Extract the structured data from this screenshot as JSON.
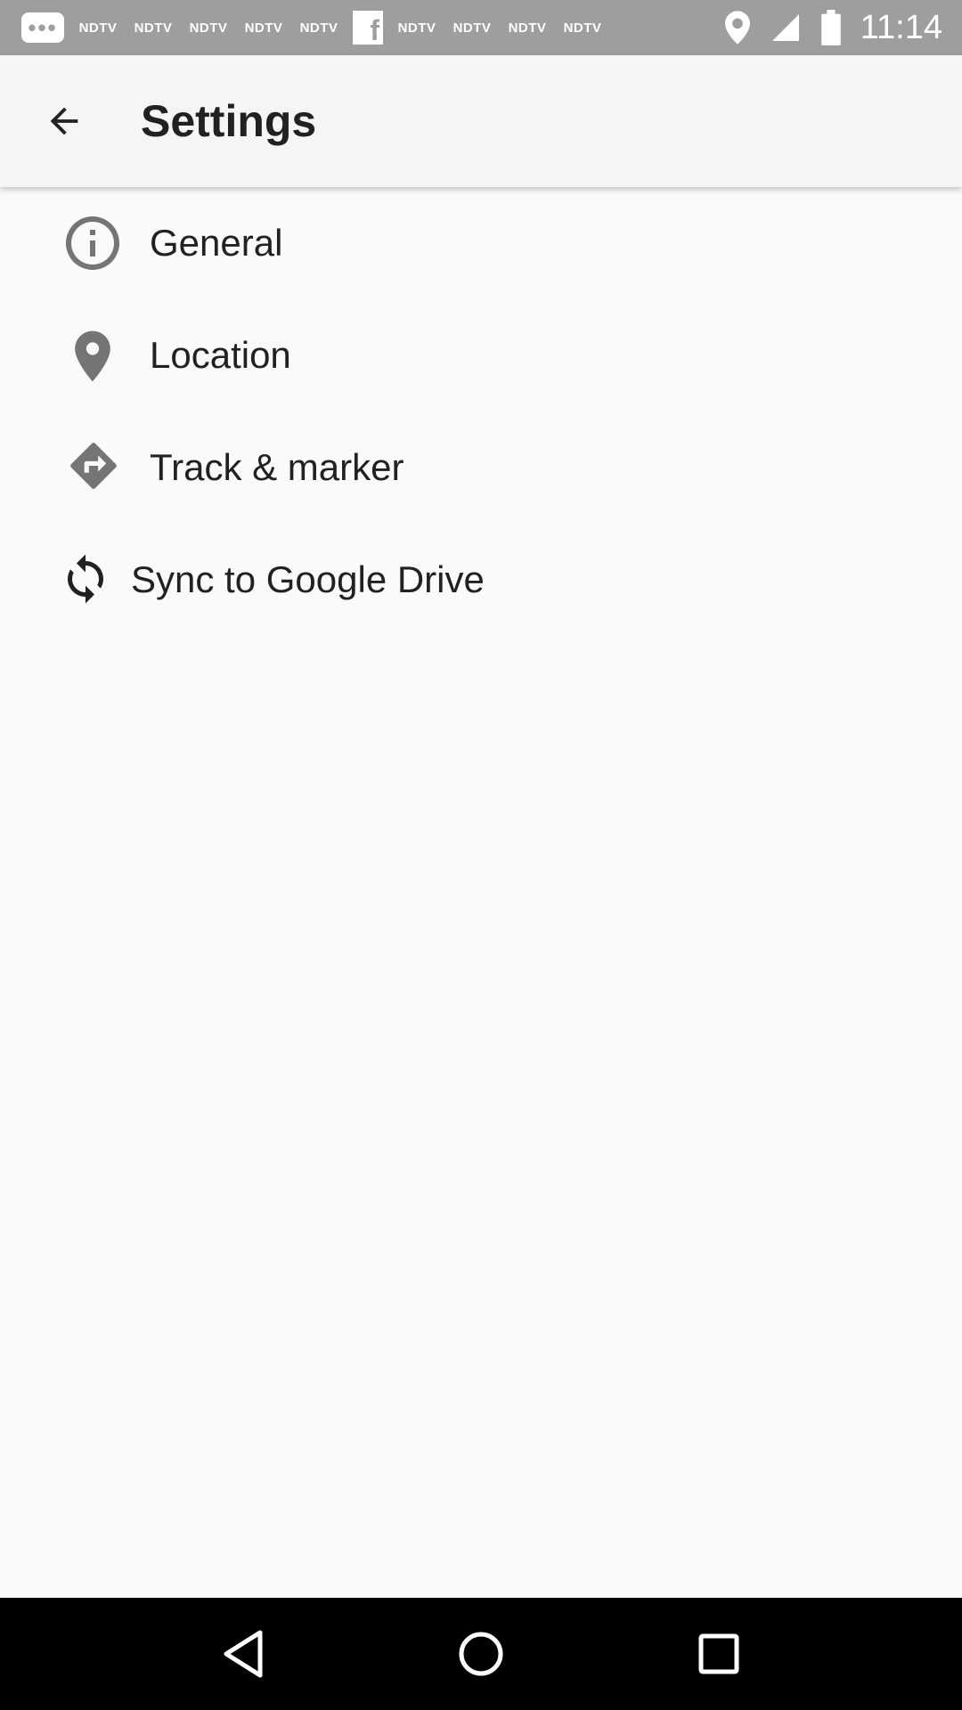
{
  "status_bar": {
    "notifications": [
      "NDTV",
      "NDTV",
      "NDTV",
      "NDTV",
      "NDTV",
      "NDTV",
      "NDTV",
      "NDTV",
      "NDTV"
    ],
    "time": "11:14",
    "icons": [
      "more-chip-icon",
      "facebook-icon",
      "location-icon",
      "signal-icon",
      "battery-icon"
    ]
  },
  "app_bar": {
    "title": "Settings",
    "back_icon": "arrow-back-icon"
  },
  "settings": {
    "items": [
      {
        "label": "General",
        "icon": "info-icon"
      },
      {
        "label": "Location",
        "icon": "location-pin-icon"
      },
      {
        "label": "Track & marker",
        "icon": "directions-icon"
      },
      {
        "label": "Sync to Google Drive",
        "icon": "sync-icon"
      }
    ]
  },
  "nav_bar": {
    "icons": [
      "back-triangle-icon",
      "home-circle-icon",
      "recents-square-icon"
    ]
  },
  "colors": {
    "status_bar": "#9e9e9e",
    "app_bar": "#f5f5f5",
    "background": "#fafafa",
    "icon": "#757575",
    "text": "#212121",
    "nav_bar": "#000000"
  }
}
